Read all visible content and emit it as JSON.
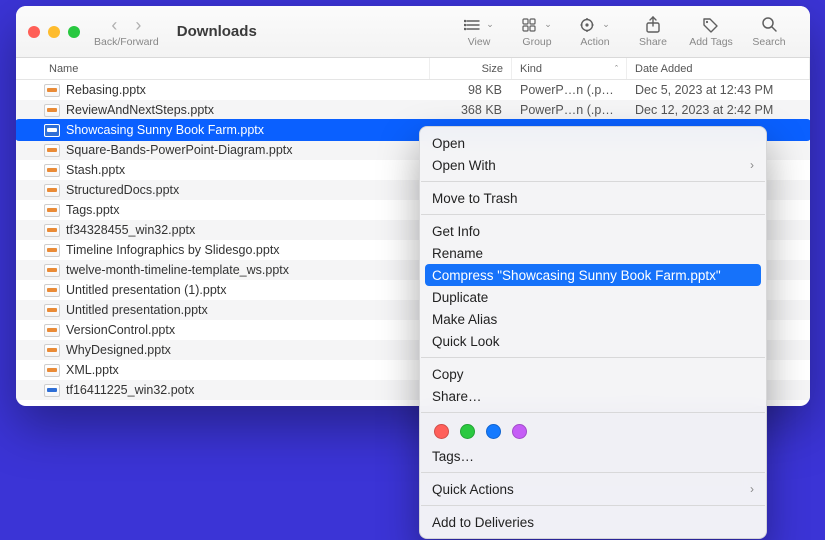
{
  "window": {
    "title": "Downloads",
    "back_forward_label": "Back/Forward"
  },
  "toolbar": {
    "view": "View",
    "group": "Group",
    "action": "Action",
    "share": "Share",
    "tags": "Add Tags",
    "search": "Search"
  },
  "columns": {
    "name": "Name",
    "size": "Size",
    "kind": "Kind",
    "date": "Date Added"
  },
  "files": [
    {
      "name": "Rebasing.pptx",
      "size": "98 KB",
      "kind": "PowerP…n (.pptx)",
      "date": "Dec 5, 2023 at 12:43 PM"
    },
    {
      "name": "ReviewAndNextSteps.pptx",
      "size": "368 KB",
      "kind": "PowerP…n (.pptx)",
      "date": "Dec 12, 2023 at 2:42 PM"
    },
    {
      "name": "Showcasing Sunny Book Farm.pptx",
      "size": "",
      "kind": "",
      "date": "",
      "selected": true
    },
    {
      "name": "Square-Bands-PowerPoint-Diagram.pptx",
      "size": "",
      "kind": "",
      "date": ""
    },
    {
      "name": "Stash.pptx",
      "size": "",
      "kind": "",
      "date": ""
    },
    {
      "name": "StructuredDocs.pptx",
      "size": "",
      "kind": "",
      "date": ""
    },
    {
      "name": "Tags.pptx",
      "size": "",
      "kind": "",
      "date": "M"
    },
    {
      "name": "tf34328455_win32.pptx",
      "size": "",
      "kind": "",
      "date": "M"
    },
    {
      "name": "Timeline Infographics by Slidesgo.pptx",
      "size": "",
      "kind": "",
      "date": ""
    },
    {
      "name": "twelve-month-timeline-template_ws.pptx",
      "size": "",
      "kind": "",
      "date": ""
    },
    {
      "name": "Untitled presentation (1).pptx",
      "size": "",
      "kind": "",
      "date": ""
    },
    {
      "name": "Untitled presentation.pptx",
      "size": "",
      "kind": "",
      "date": ""
    },
    {
      "name": "VersionControl.pptx",
      "size": "",
      "kind": "",
      "date": "M"
    },
    {
      "name": "WhyDesigned.pptx",
      "size": "",
      "kind": "",
      "date": ""
    },
    {
      "name": "XML.pptx",
      "size": "",
      "kind": "",
      "date": "M"
    },
    {
      "name": "tf16411225_win32.potx",
      "size": "",
      "kind": "",
      "date": "M",
      "blue": true
    }
  ],
  "context_menu": {
    "open": "Open",
    "open_with": "Open With",
    "trash": "Move to Trash",
    "get_info": "Get Info",
    "rename": "Rename",
    "compress": "Compress \"Showcasing Sunny Book Farm.pptx\"",
    "duplicate": "Duplicate",
    "make_alias": "Make Alias",
    "quick_look": "Quick Look",
    "copy": "Copy",
    "share": "Share…",
    "tags": "Tags…",
    "quick_actions": "Quick Actions",
    "add_deliveries": "Add to Deliveries",
    "tag_colors": [
      "#ff5f5a",
      "#2bc940",
      "#147aff",
      "#c55df6"
    ]
  }
}
